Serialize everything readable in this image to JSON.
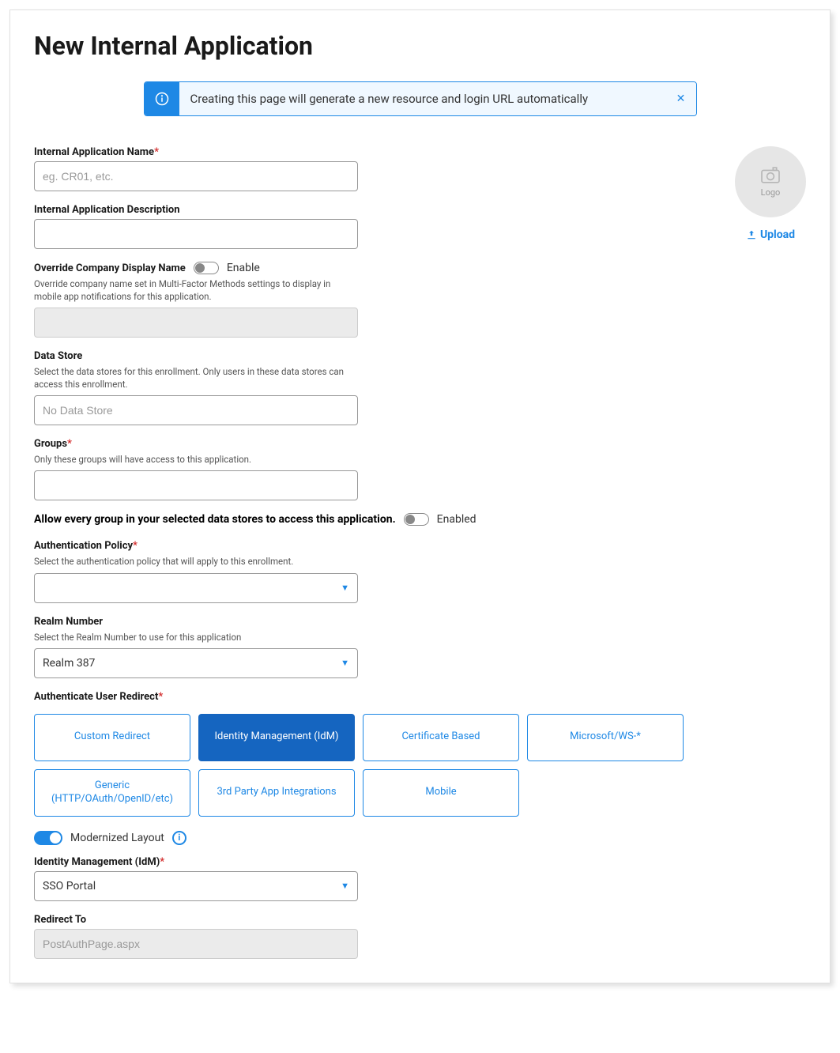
{
  "title": "New Internal Application",
  "banner": {
    "text": "Creating this page will generate a new resource and login URL automatically"
  },
  "logo": {
    "placeholder": "Logo",
    "upload_label": "Upload"
  },
  "fields": {
    "app_name": {
      "label": "Internal Application Name",
      "placeholder": "eg. CR01, etc."
    },
    "app_desc": {
      "label": "Internal Application Description"
    },
    "override_name": {
      "label": "Override Company Display Name",
      "toggle_text": "Enable",
      "help": "Override company name set in Multi-Factor Methods settings to display in mobile app notifications for this application."
    },
    "data_store": {
      "label": "Data Store",
      "help": "Select the data stores for this enrollment. Only users in these data stores can access this enrollment.",
      "placeholder": "No Data Store"
    },
    "groups": {
      "label": "Groups",
      "help": "Only these groups will have access to this application."
    },
    "allow_every": {
      "label": "Allow every group in your selected data stores to access this application.",
      "toggle_text": "Enabled"
    },
    "auth_policy": {
      "label": "Authentication Policy",
      "help": "Select the authentication policy that will apply to this enrollment."
    },
    "realm": {
      "label": "Realm Number",
      "help": "Select the Realm Number to use for this application",
      "value": "Realm 387"
    },
    "auth_redirect": {
      "label": "Authenticate User Redirect"
    },
    "redirect_tiles": [
      "Custom Redirect",
      "Identity Management (IdM)",
      "Certificate Based",
      "Microsoft/WS-*",
      "Generic (HTTP/OAuth/OpenID/etc)",
      "3rd Party App Integrations",
      "Mobile"
    ],
    "modernized": {
      "label": "Modernized Layout"
    },
    "idm": {
      "label": "Identity Management (IdM)",
      "value": "SSO Portal"
    },
    "redirect_to": {
      "label": "Redirect To",
      "placeholder": "PostAuthPage.aspx"
    }
  }
}
